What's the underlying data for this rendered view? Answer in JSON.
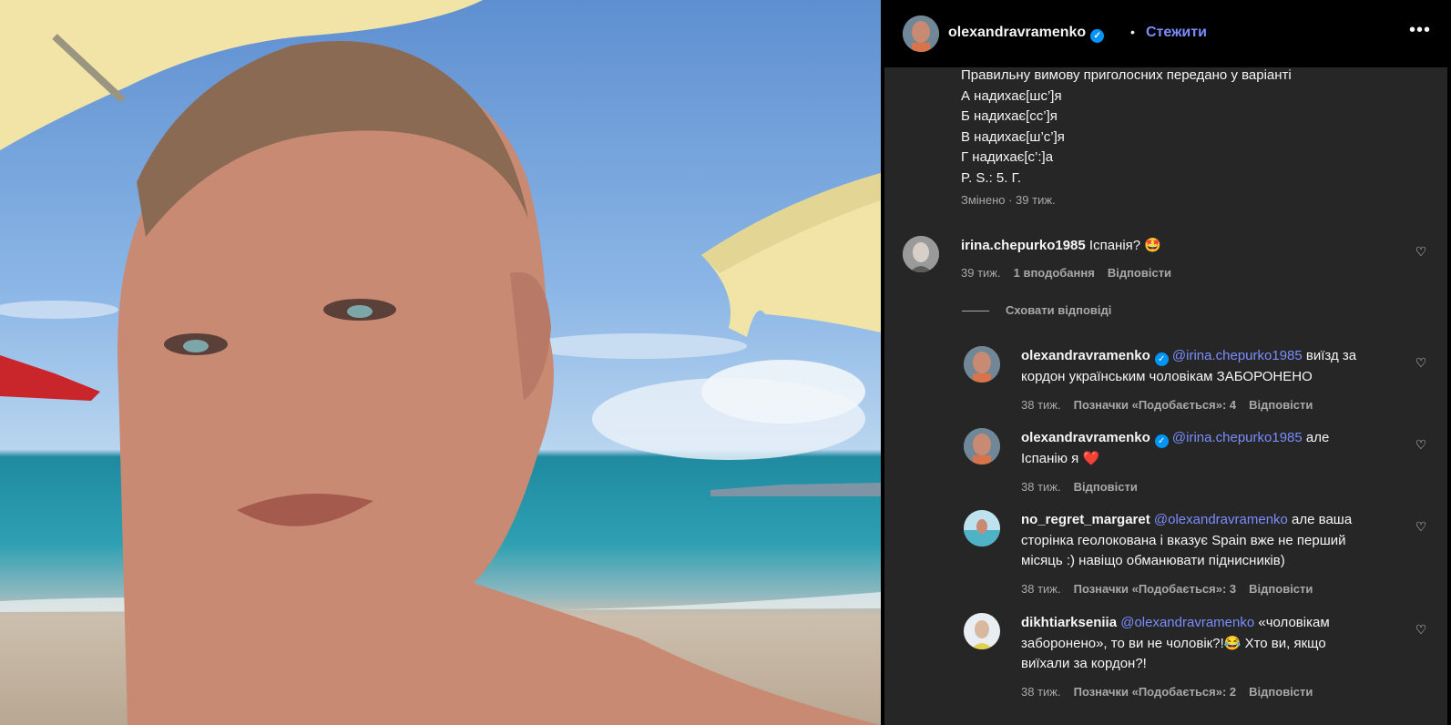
{
  "post": {
    "author": "olexandravramenko",
    "follow_label": "Стежити",
    "more_icon": "more-horizontal-icon",
    "caption_lines": [
      "Правильну вимову приголосних передано у варіанті",
      "А надихає[шс’]я",
      "Б надихає[сс’]я",
      "В надихає[ш’с’]я",
      "Г надихає[с’:]а",
      "P. S.: 5. Г."
    ],
    "edited_label": "Змінено · 39 тиж."
  },
  "comment": {
    "username": "irina.chepurko1985",
    "text": "Іспанія? 🤩",
    "time": "39 тиж.",
    "likes": "1 вподобання",
    "reply_label": "Відповісти"
  },
  "hide_replies_label": "Сховати відповіді",
  "replies": [
    {
      "username": "olexandravramenko",
      "mention": "@irina.chepurko1985",
      "line1": "виїзд за",
      "line2": "кордон українським чоловікам ЗАБОРОНЕНО",
      "time": "38 тиж.",
      "likes": "Позначки «Подобається»: 4",
      "reply_label": "Відповісти"
    },
    {
      "username": "olexandravramenko",
      "mention": "@irina.chepurko1985",
      "line1": "але",
      "line2": "Іспанію я ❤️",
      "time": "38 тиж.",
      "reply_label": "Відповісти"
    },
    {
      "username": "no_regret_margaret",
      "mention": "@olexandravramenko",
      "line1": "але ваша",
      "line2": "сторінка геолокована і вказує Spain вже не перший",
      "line3": "місяць :) навіщо обманювати піднисників)",
      "time": "38 тиж.",
      "likes": "Позначки «Подобається»: 3",
      "reply_label": "Відповісти"
    },
    {
      "username": "dikhtiarkseniia",
      "mention": "@olexandravramenko",
      "line1": "«чоловікам",
      "line2": "заборонено», то ви не чоловік?!😂  Хто ви, якщо",
      "line3": "виїхали за кордон?!",
      "time": "38 тиж.",
      "likes": "Позначки «Подобається»: 2",
      "reply_label": "Відповісти"
    }
  ],
  "colors": {
    "panel_bg": "#262626",
    "header_bg": "#000000",
    "link": "#7a8dff",
    "verified": "#0095f6",
    "muted": "#a8a8a8"
  }
}
